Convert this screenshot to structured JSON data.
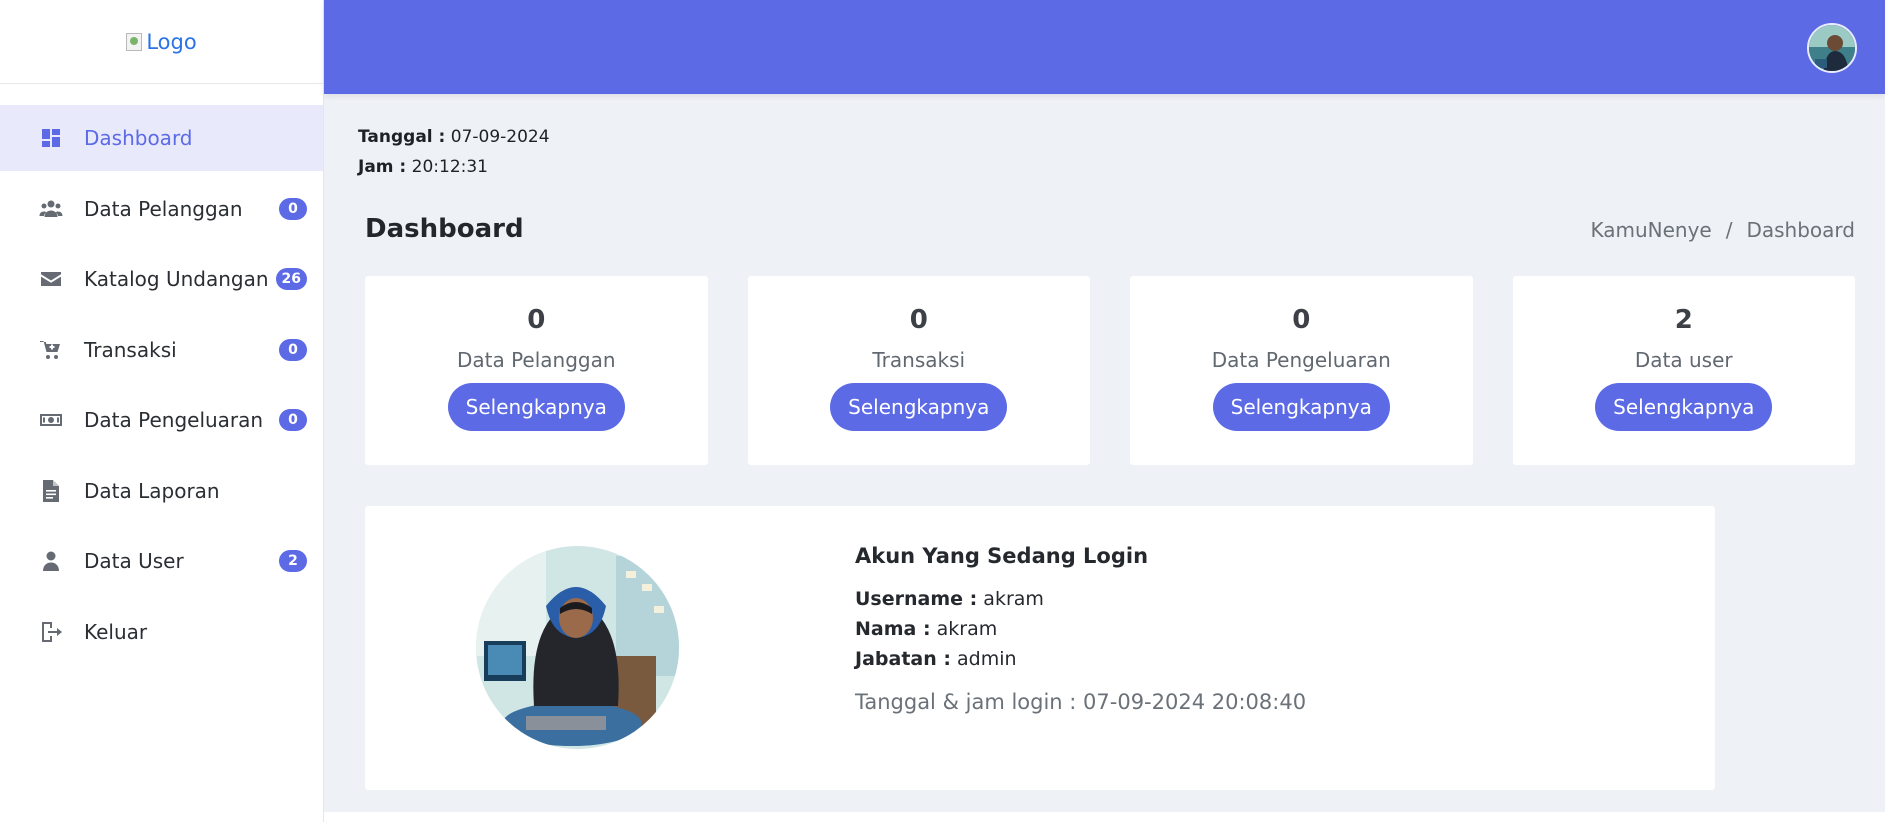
{
  "logo": {
    "alt": "Logo"
  },
  "sidebar": {
    "items": [
      {
        "label": "Dashboard",
        "icon": "dashboard-icon",
        "badge": "",
        "active": true
      },
      {
        "label": "Data Pelanggan",
        "icon": "users-icon",
        "badge": "0"
      },
      {
        "label": "Katalog Undangan",
        "icon": "envelope-icon",
        "badge": "26"
      },
      {
        "label": "Transaksi",
        "icon": "cart-icon",
        "badge": "0"
      },
      {
        "label": "Data Pengeluaran",
        "icon": "money-icon",
        "badge": "0"
      },
      {
        "label": "Data Laporan",
        "icon": "file-icon",
        "badge": ""
      },
      {
        "label": "Data User",
        "icon": "user-icon",
        "badge": "2"
      },
      {
        "label": "Keluar",
        "icon": "logout-icon",
        "badge": ""
      }
    ]
  },
  "header": {
    "accent_color": "#5c6ae6"
  },
  "datetime": {
    "date_label": "Tanggal :",
    "date_value": "07-09-2024",
    "time_label": "Jam :",
    "time_value": "20:12:31"
  },
  "page": {
    "title": "Dashboard",
    "breadcrumb": [
      "KamuNenye",
      "Dashboard"
    ],
    "breadcrumb_sep": "/"
  },
  "cards": [
    {
      "value": "0",
      "label": "Data Pelanggan",
      "button": "Selengkapnya"
    },
    {
      "value": "0",
      "label": "Transaksi",
      "button": "Selengkapnya"
    },
    {
      "value": "0",
      "label": "Data Pengeluaran",
      "button": "Selengkapnya"
    },
    {
      "value": "2",
      "label": "Data user",
      "button": "Selengkapnya"
    }
  ],
  "profile": {
    "heading": "Akun Yang Sedang Login",
    "username_label": "Username :",
    "username": "akram",
    "nama_label": "Nama :",
    "nama": "akram",
    "jabatan_label": "Jabatan :",
    "jabatan": "admin",
    "login_time": "Tanggal & jam login : 07-09-2024 20:08:40"
  }
}
